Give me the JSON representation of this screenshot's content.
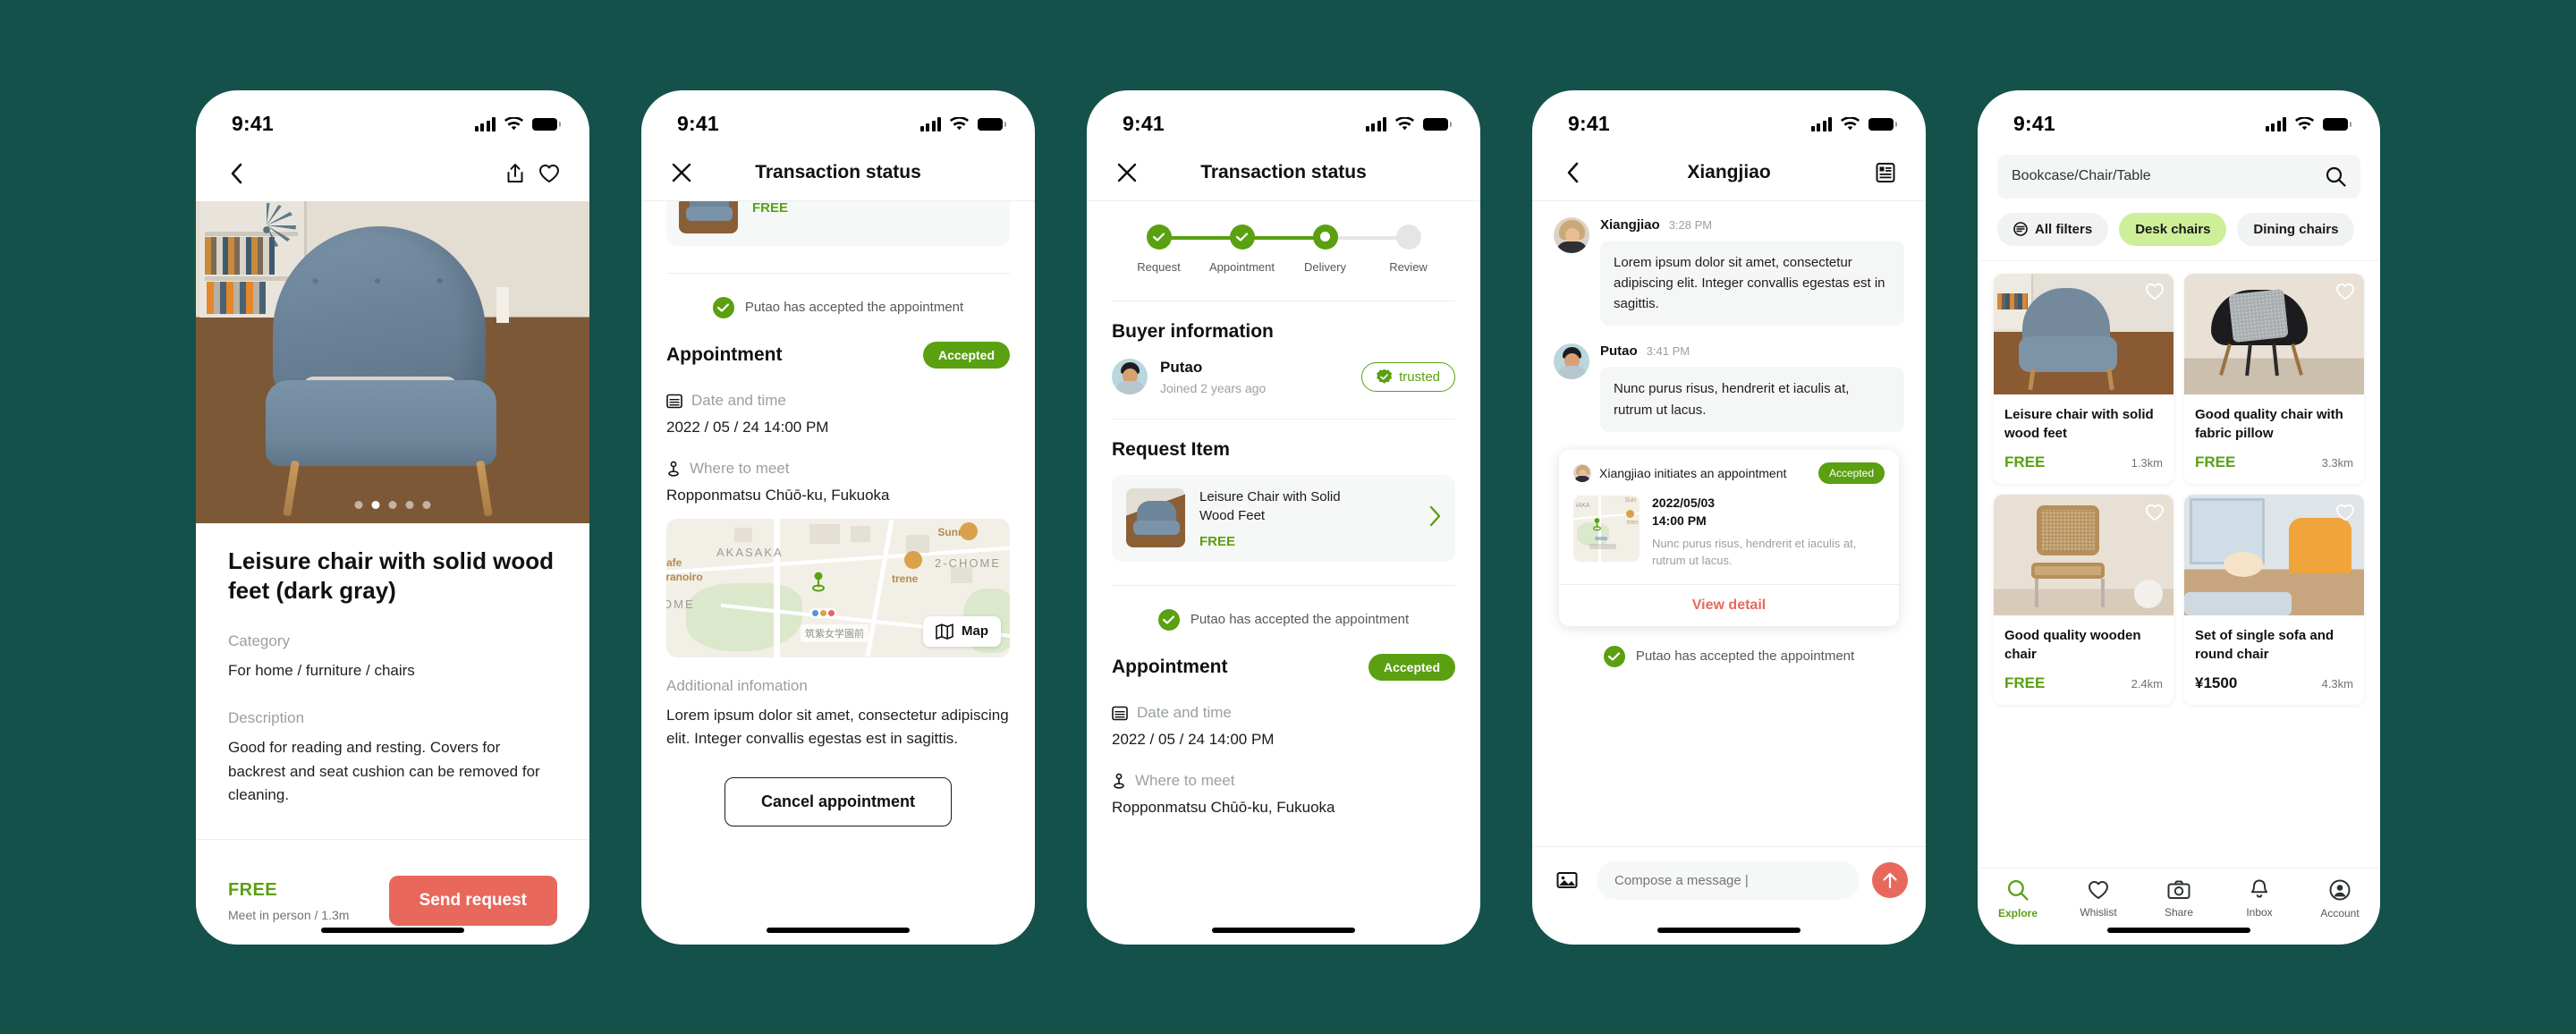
{
  "status_bar": {
    "time": "9:41"
  },
  "phone1": {
    "nav": {
      "back_icon": "chevron-left-icon",
      "share_icon": "share-icon",
      "favorite_icon": "heart-icon"
    },
    "carousel": {
      "total_dots": 5,
      "active_index": 1
    },
    "title": "Leisure chair with solid wood feet (dark gray)",
    "category_label": "Category",
    "category_value": "For home / furniture / chairs",
    "description_label": "Description",
    "description_value": "Good for reading and resting. Covers for backrest and seat cushion can be removed for cleaning.",
    "price": "FREE",
    "price_sub": "Meet in person / 1.3m",
    "cta": "Send request"
  },
  "phone2": {
    "nav": {
      "close_icon": "close-icon",
      "title": "Transaction status"
    },
    "item_card": {
      "price": "FREE"
    },
    "accept_note": "Putao has accepted the appointment",
    "appointment_title": "Appointment",
    "appointment_status": "Accepted",
    "date_label": "Date and time",
    "date_value": "2022 / 05 / 24  14:00 PM",
    "place_label": "Where to meet",
    "place_value": "Ropponmatsu Chūō-ku, Fukuoka",
    "map": {
      "button": "Map",
      "area_label": "AKASAKA",
      "chome_label": "2-CHOME",
      "chome_label2": "OME",
      "poi_sunny": "Sunny",
      "poi_cafe": "afe",
      "poi_cafe2": "oranoiro",
      "poi_trene": "trene",
      "station": "筑紫女学園前"
    },
    "additional_label": "Additional infomation",
    "additional_value": "Lorem ipsum dolor sit amet, consectetur adipiscing elit. Integer convallis egestas est in sagittis.",
    "cancel_button": "Cancel appointment"
  },
  "phone3": {
    "nav": {
      "close_icon": "close-icon",
      "title": "Transaction status"
    },
    "steps": [
      {
        "label": "Request",
        "state": "done"
      },
      {
        "label": "Appointment",
        "state": "done"
      },
      {
        "label": "Delivery",
        "state": "current"
      },
      {
        "label": "Review",
        "state": "pending"
      }
    ],
    "buyer_heading": "Buyer information",
    "buyer": {
      "name": "Putao",
      "joined": "Joined 2 years ago",
      "badge": "trusted"
    },
    "request_heading": "Request Item",
    "request_item": {
      "name": "Leisure Chair with Solid Wood Feet",
      "price": "FREE"
    },
    "accept_note": "Putao has accepted the appointment",
    "appointment_title": "Appointment",
    "appointment_status": "Accepted",
    "date_label": "Date and time",
    "date_value": "2022 / 05 / 24  14:00 PM",
    "place_label": "Where to meet",
    "place_value": "Ropponmatsu Chūō-ku, Fukuoka"
  },
  "phone4": {
    "nav": {
      "back_icon": "chevron-left-icon",
      "title": "Xiangjiao",
      "list_icon": "list-detail-icon"
    },
    "messages": [
      {
        "name": "Xiangjiao",
        "time": "3:28 PM",
        "text": "Lorem ipsum dolor sit amet, consectetur adipiscing elit. Integer convallis egestas est in sagittis."
      },
      {
        "name": "Putao",
        "time": "3:41 PM",
        "text": "Nunc purus risus, hendrerit et iaculis at, rutrum ut lacus."
      }
    ],
    "appointment_card": {
      "header": "Xiangjiao initiates an appointment",
      "status": "Accepted",
      "date": "2022/05/03",
      "time": "14:00 PM",
      "note": "Nunc purus risus, hendrerit et iaculis at, rutrum ut lacus.",
      "link": "View detail"
    },
    "accept_note": "Putao has accepted the appointment",
    "composer": {
      "placeholder": "Compose a message |",
      "image_icon": "image-icon",
      "send_icon": "arrow-up-icon"
    }
  },
  "phone5": {
    "search": {
      "placeholder": "Bookcase/Chair/Table",
      "icon": "search-icon"
    },
    "chips": [
      {
        "label": "All filters",
        "active": false,
        "icon": "filter-icon"
      },
      {
        "label": "Desk chairs",
        "active": true
      },
      {
        "label": "Dining chairs",
        "active": false
      }
    ],
    "cards": [
      {
        "title": "Leisure chair with solid wood feet",
        "price": "FREE",
        "distance": "1.3km",
        "photo": "blue-armchair"
      },
      {
        "title": "Good quality chair with fabric pillow",
        "price": "FREE",
        "distance": "3.3km",
        "photo": "black-eames-chair"
      },
      {
        "title": "Good quality wooden chair",
        "price": "FREE",
        "distance": "2.4km",
        "photo": "rattan-chair"
      },
      {
        "title": "Set of single sofa and round chair",
        "price": "¥1500",
        "distance": "4.3km",
        "photo": "orange-sofa"
      }
    ],
    "tabs": [
      {
        "label": "Explore",
        "icon": "search-icon",
        "active": true
      },
      {
        "label": "Whislist",
        "icon": "heart-icon",
        "active": false
      },
      {
        "label": "Share",
        "icon": "camera-icon",
        "active": false
      },
      {
        "label": "Inbox",
        "icon": "bell-icon",
        "active": false
      },
      {
        "label": "Account",
        "icon": "account-icon",
        "active": false
      }
    ]
  },
  "colors": {
    "background": "#14514A",
    "green": "#5AA011",
    "chip_green": "#CEEF9A",
    "coral": "#E8685C",
    "text": "#111111",
    "muted": "#9AA0A0"
  }
}
